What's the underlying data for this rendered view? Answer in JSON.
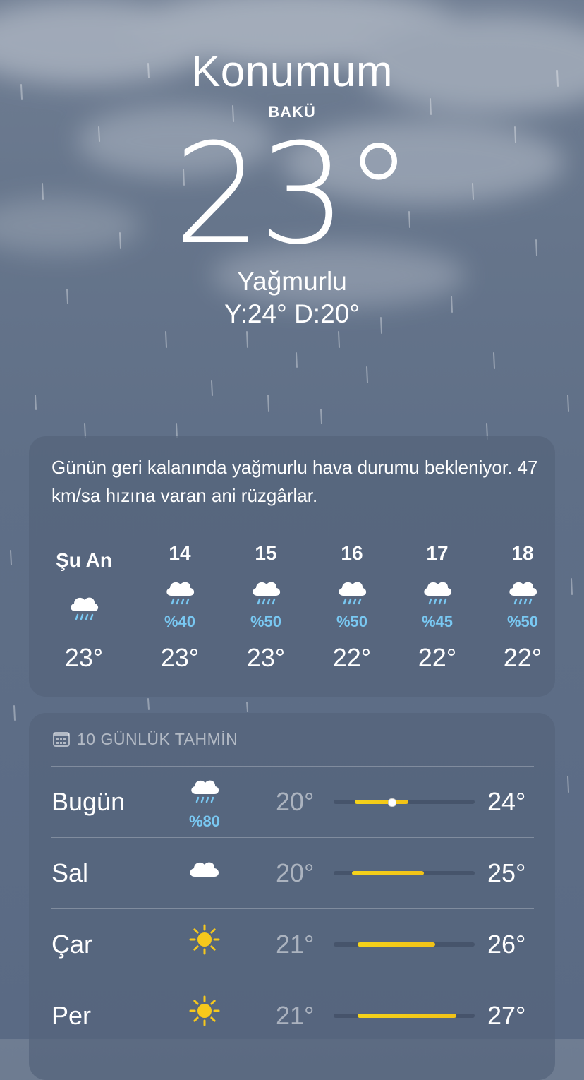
{
  "header": {
    "title": "Konumum",
    "city": "BAKÜ",
    "temperature": "23°",
    "condition": "Yağmurlu",
    "high_low": "Y:24° D:20°"
  },
  "hourly_card": {
    "summary": "Günün geri kalanında yağmurlu hava durumu bekleniyor. 47 km/sa hızına varan ani rüzgârlar.",
    "hours": [
      {
        "label": "Şu An",
        "icon": "rain-cloud-icon",
        "precip": "",
        "temp": "23°"
      },
      {
        "label": "14",
        "icon": "rain-cloud-icon",
        "precip": "%40",
        "temp": "23°"
      },
      {
        "label": "15",
        "icon": "rain-cloud-icon",
        "precip": "%50",
        "temp": "23°"
      },
      {
        "label": "16",
        "icon": "rain-cloud-icon",
        "precip": "%50",
        "temp": "22°"
      },
      {
        "label": "17",
        "icon": "rain-cloud-icon",
        "precip": "%45",
        "temp": "22°"
      },
      {
        "label": "18",
        "icon": "rain-cloud-icon",
        "precip": "%50",
        "temp": "22°"
      }
    ]
  },
  "forecast_card": {
    "title": "10 GÜNLÜK TAHMİN",
    "title_icon": "calendar-icon",
    "range_bar_color": "#f5c518",
    "days": [
      {
        "day": "Bugün",
        "icon": "rain-cloud-icon",
        "precip": "%80",
        "low": "20°",
        "high": "24°",
        "fill_start": 0.15,
        "fill_end": 0.53,
        "current_marker": 0.41
      },
      {
        "day": "Sal",
        "icon": "cloud-icon",
        "precip": "",
        "low": "20°",
        "high": "25°",
        "fill_start": 0.13,
        "fill_end": 0.64
      },
      {
        "day": "Çar",
        "icon": "sun-icon",
        "precip": "",
        "low": "21°",
        "high": "26°",
        "fill_start": 0.17,
        "fill_end": 0.72
      },
      {
        "day": "Per",
        "icon": "sun-icon",
        "precip": "",
        "low": "21°",
        "high": "27°",
        "fill_start": 0.17,
        "fill_end": 0.87
      }
    ]
  }
}
